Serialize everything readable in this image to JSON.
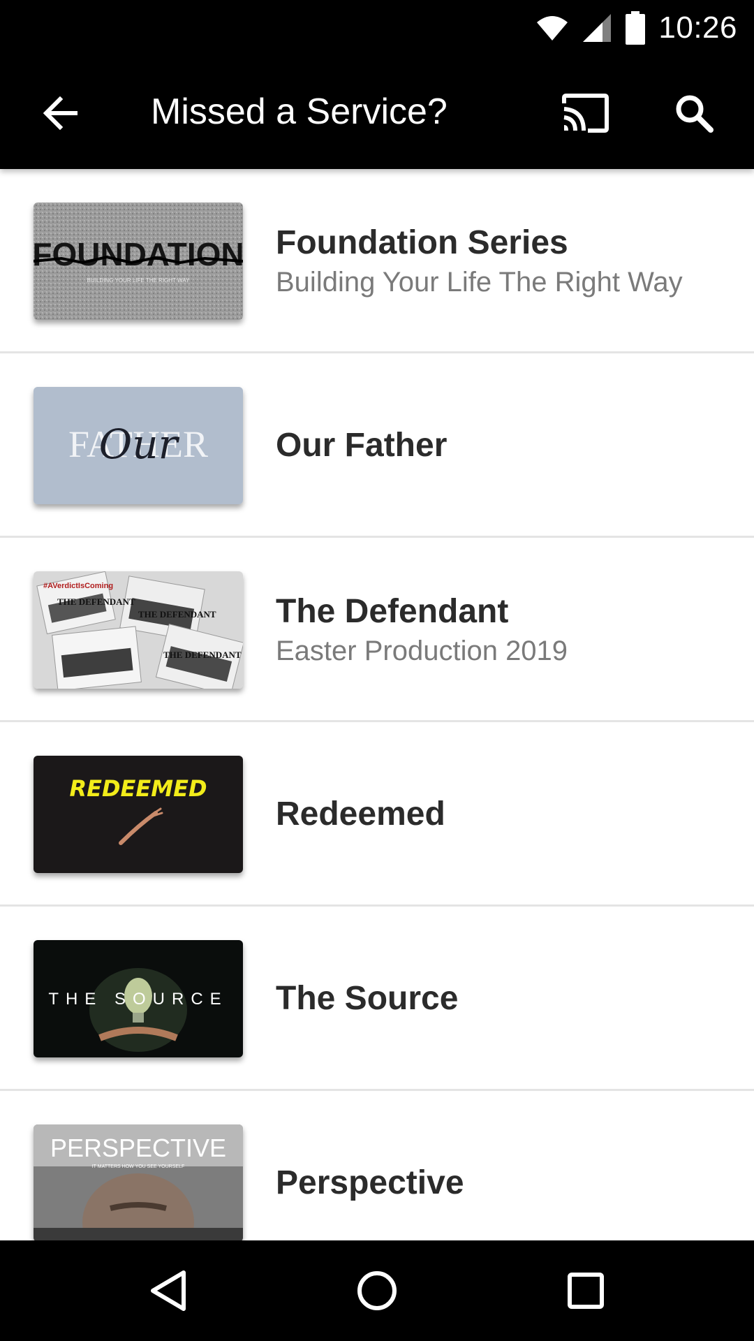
{
  "status_bar": {
    "time": "10:26",
    "icons": [
      "wifi-icon",
      "cellular-signal-icon",
      "battery-icon"
    ]
  },
  "app_bar": {
    "title": "Missed a Service?",
    "back_icon": "arrow-back-icon",
    "cast_icon": "cast-icon",
    "search_icon": "search-icon",
    "background": "#000000"
  },
  "series": [
    {
      "title": "Foundation Series",
      "subtitle": "Building Your Life The Right Way",
      "thumb_text": "FOUNDATION",
      "thumb_caption": "BUILDING YOUR LIFE THE RIGHT WAY"
    },
    {
      "title": "Our Father",
      "subtitle": "",
      "thumb_text": "FATHER",
      "thumb_script": "Our"
    },
    {
      "title": "The Defendant",
      "subtitle": "Easter Production 2019",
      "thumb_text": "THE DEFENDANT",
      "thumb_hashtag": "#AVerdictIsComing"
    },
    {
      "title": "Redeemed",
      "subtitle": "",
      "thumb_text": "REDEEMED"
    },
    {
      "title": "The Source",
      "subtitle": "",
      "thumb_text": "THE SOURCE"
    },
    {
      "title": "Perspective",
      "subtitle": "",
      "thumb_text": "PERSPECTIVE",
      "thumb_caption": "IT MATTERS HOW YOU SEE YOURSELF"
    }
  ],
  "nav_bar": {
    "back_icon": "nav-back-icon",
    "home_icon": "nav-home-icon",
    "recents_icon": "nav-recents-icon"
  },
  "colors": {
    "title_text": "#2b2b2b",
    "subtitle_text": "#7a7a7a",
    "divider": "#e4e4e4",
    "redeemed_yellow": "#f2ec1a"
  }
}
